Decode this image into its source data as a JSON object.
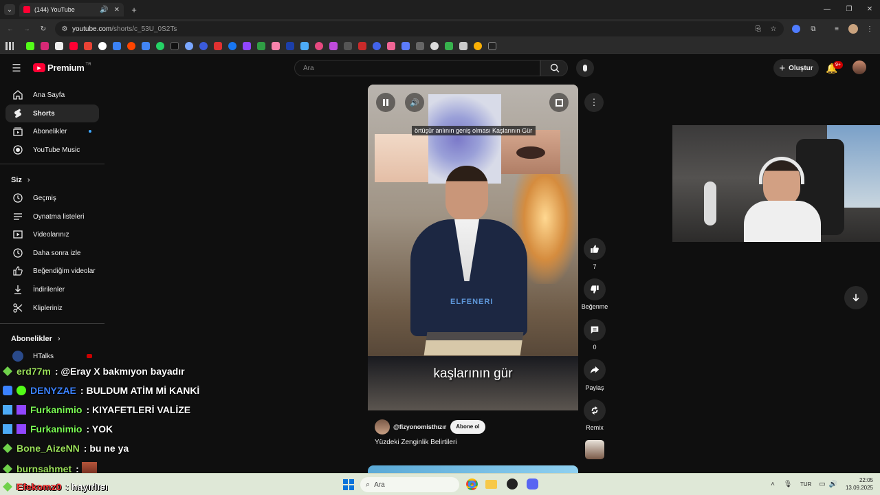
{
  "browser": {
    "tab_title": "(144) YouTube",
    "url_domain": "youtube.com",
    "url_path": "/shorts/c_53U_0S2Ts",
    "new_tab": "+"
  },
  "youtube": {
    "logo_text": "Premium",
    "logo_region": "TR",
    "search_placeholder": "Ara",
    "create_label": "Oluştur",
    "notif_count": "9+",
    "sidebar": {
      "main": [
        {
          "label": "Ana Sayfa",
          "icon": "home-icon"
        },
        {
          "label": "Shorts",
          "icon": "shorts-icon"
        },
        {
          "label": "Abonelikler",
          "icon": "subscriptions-icon"
        },
        {
          "label": "YouTube Music",
          "icon": "music-icon"
        }
      ],
      "you_header": "Siz",
      "you": [
        {
          "label": "Geçmiş",
          "icon": "history-icon"
        },
        {
          "label": "Oynatma listeleri",
          "icon": "playlist-icon"
        },
        {
          "label": "Videolarınız",
          "icon": "your-videos-icon"
        },
        {
          "label": "Daha sonra izle",
          "icon": "watch-later-icon"
        },
        {
          "label": "Beğendiğim videolar",
          "icon": "liked-icon"
        },
        {
          "label": "İndirilenler",
          "icon": "download-icon"
        },
        {
          "label": "Klipleriniz",
          "icon": "clips-icon"
        }
      ],
      "subs_header": "Abonelikler",
      "subs": [
        {
          "label": "HTalks"
        }
      ]
    },
    "short": {
      "overlay_text": "örtüşür anlının geniş olması Kaşlarının Gür",
      "caption": "kaşlarının gür",
      "watermark": "ELFENERI",
      "channel": "@fizyonomisthızır",
      "subscribe": "Abone ol",
      "title": "Yüzdeki Zenginlik Belirtileri"
    },
    "actions": {
      "like_count": "7",
      "dislike_label": "Beğenme",
      "comment_count": "0",
      "share_label": "Paylaş",
      "remix_label": "Remix"
    }
  },
  "chat": [
    {
      "user": "erd77m",
      "message": ": @Eray X bakmıyon bayadır",
      "color": "#9be05a"
    },
    {
      "user": "DENYZAE",
      "message": ": BULDUM ATİM Mİ KANKİ",
      "color": "#3b82ff"
    },
    {
      "user": "Furkanimio",
      "message": ": KIYAFETLERİ VALİZE",
      "color": "#7cff55"
    },
    {
      "user": "Furkanimio",
      "message": ": YOK",
      "color": "#7cff55"
    },
    {
      "user": "Bone_AizeNN",
      "message": ": bu ne ya",
      "color": "#9be05a"
    },
    {
      "user": "burnsahmet",
      "message": ":",
      "color": "#9be05a"
    },
    {
      "user": "Efekomz0",
      "message": ": hayırlısı",
      "color": "#ff3b3b"
    }
  ],
  "taskbar": {
    "search_placeholder": "Ara",
    "lang": "TUR",
    "time": "22:05",
    "date": "13.09.2025"
  }
}
